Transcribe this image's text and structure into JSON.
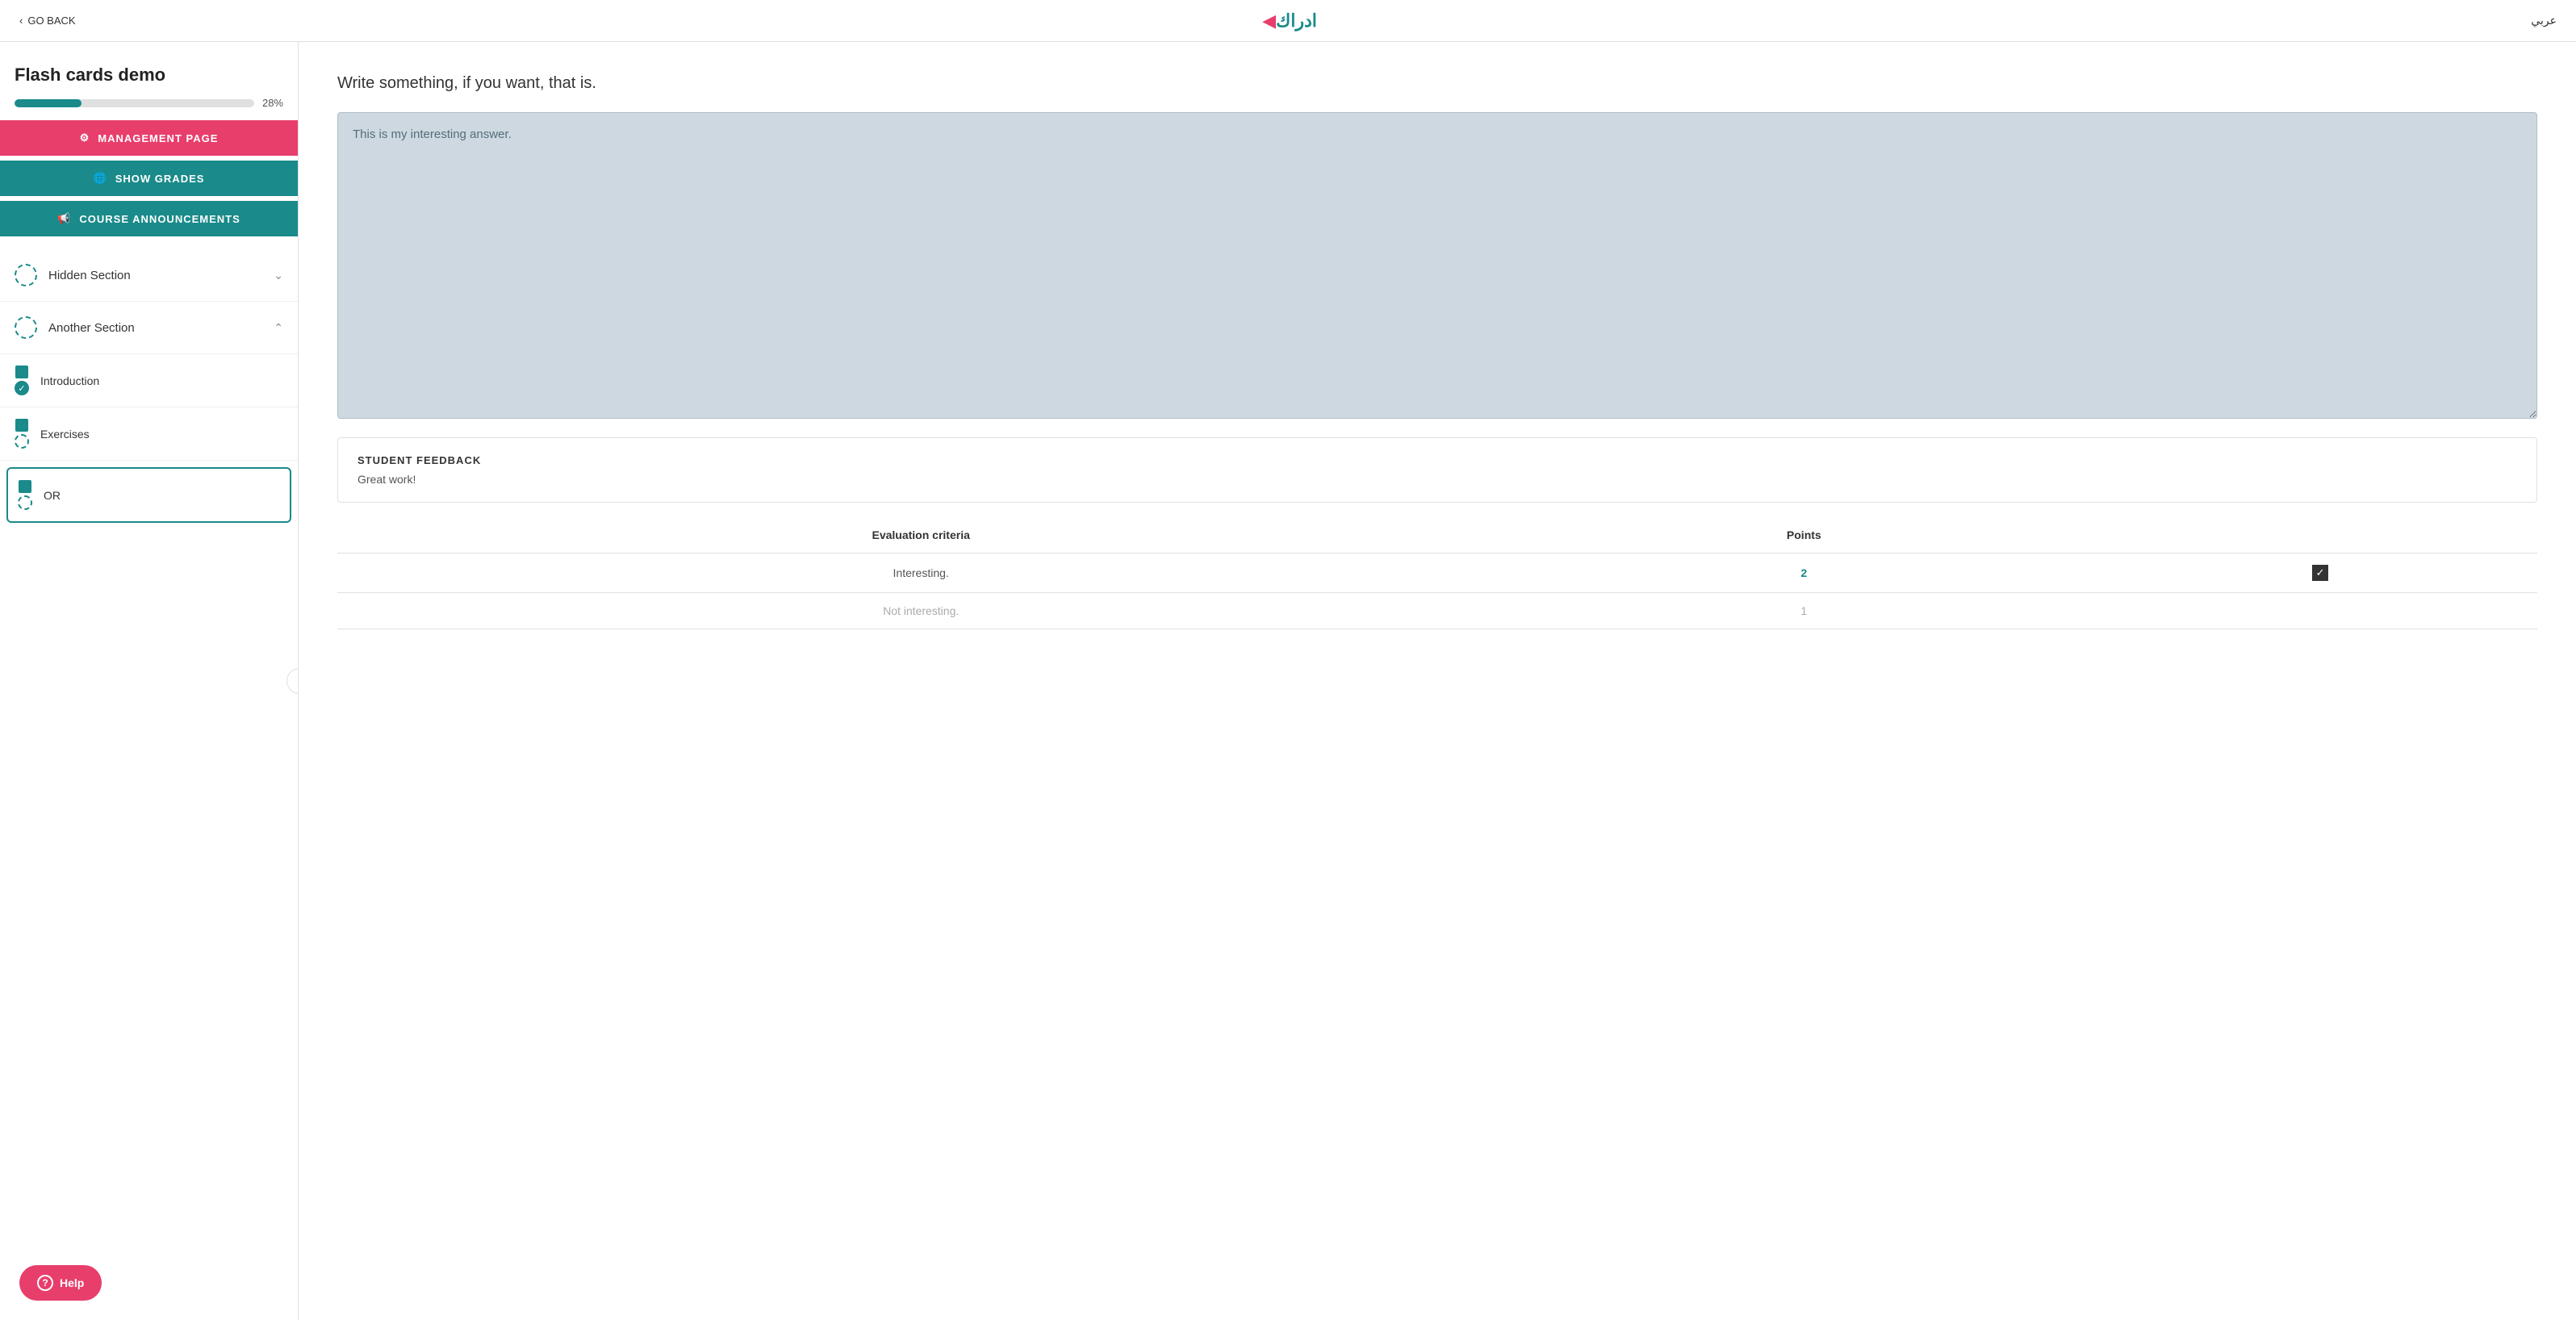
{
  "header": {
    "back_label": "GO BACK",
    "logo_text": "ادراك",
    "lang_label": "عربي"
  },
  "sidebar": {
    "title": "Flash cards demo",
    "progress_pct": "28%",
    "progress_value": 28,
    "buttons": {
      "management": "MANAGEMENT PAGE",
      "grades": "SHOW GRADES",
      "announcements": "COURSE ANNOUNCEMENTS"
    },
    "sections": [
      {
        "label": "Hidden Section",
        "expanded": false
      },
      {
        "label": "Another Section",
        "expanded": true,
        "items": [
          {
            "label": "Introduction",
            "type": "completed"
          },
          {
            "label": "Exercises",
            "type": "partial"
          },
          {
            "label": "OR",
            "type": "active"
          }
        ]
      }
    ]
  },
  "main": {
    "prompt": "Write something, if you want, that is.",
    "answer_value": "This is my interesting answer.",
    "answer_placeholder": "This is my interesting answer.",
    "feedback": {
      "title": "STUDENT FEEDBACK",
      "text": "Great work!"
    },
    "evaluation": {
      "col_criteria": "Evaluation criteria",
      "col_points": "Points",
      "rows": [
        {
          "criteria": "Interesting.",
          "points": "2",
          "checked": true
        },
        {
          "criteria": "Not interesting.",
          "points": "1",
          "checked": false
        }
      ]
    }
  },
  "help_button": "Help"
}
